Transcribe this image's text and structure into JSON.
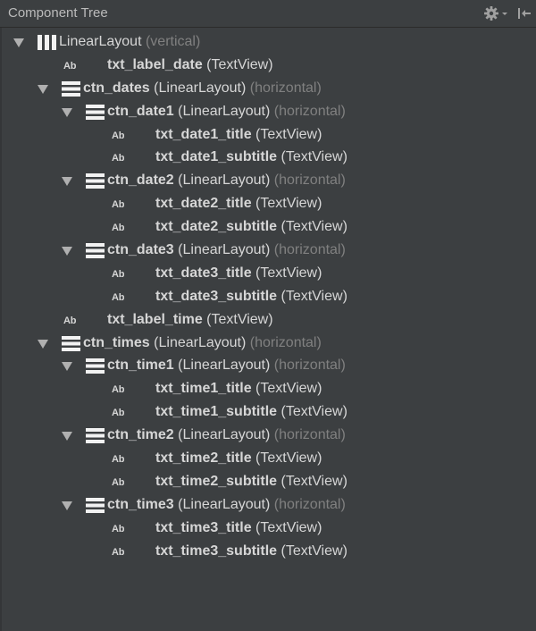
{
  "panel": {
    "title": "Component Tree",
    "settings_icon": "gear-dropdown-icon",
    "collapse_icon": "collapse-panel-icon"
  },
  "colors": {
    "background": "#3c3f41",
    "text": "#d6d6d6",
    "hint": "#808080"
  },
  "tree": [
    {
      "level": 0,
      "expanded": true,
      "icon": "vertical-layout-icon",
      "id": "",
      "type": "LinearLayout",
      "hint": "(vertical)"
    },
    {
      "level": 1,
      "expanded": null,
      "icon": "textview-icon",
      "id": "txt_label_date",
      "type": "(TextView)",
      "hint": ""
    },
    {
      "level": 1,
      "expanded": true,
      "icon": "horizontal-layout-icon",
      "id": "ctn_dates",
      "type": "(LinearLayout)",
      "hint": "(horizontal)"
    },
    {
      "level": 2,
      "expanded": true,
      "icon": "horizontal-layout-icon",
      "id": "ctn_date1",
      "type": "(LinearLayout)",
      "hint": "(horizontal)"
    },
    {
      "level": 3,
      "expanded": null,
      "icon": "textview-icon",
      "id": "txt_date1_title",
      "type": "(TextView)",
      "hint": ""
    },
    {
      "level": 3,
      "expanded": null,
      "icon": "textview-icon",
      "id": "txt_date1_subtitle",
      "type": "(TextView)",
      "hint": ""
    },
    {
      "level": 2,
      "expanded": true,
      "icon": "horizontal-layout-icon",
      "id": "ctn_date2",
      "type": "(LinearLayout)",
      "hint": "(horizontal)"
    },
    {
      "level": 3,
      "expanded": null,
      "icon": "textview-icon",
      "id": "txt_date2_title",
      "type": "(TextView)",
      "hint": ""
    },
    {
      "level": 3,
      "expanded": null,
      "icon": "textview-icon",
      "id": "txt_date2_subtitle",
      "type": "(TextView)",
      "hint": ""
    },
    {
      "level": 2,
      "expanded": true,
      "icon": "horizontal-layout-icon",
      "id": "ctn_date3",
      "type": "(LinearLayout)",
      "hint": "(horizontal)"
    },
    {
      "level": 3,
      "expanded": null,
      "icon": "textview-icon",
      "id": "txt_date3_title",
      "type": "(TextView)",
      "hint": ""
    },
    {
      "level": 3,
      "expanded": null,
      "icon": "textview-icon",
      "id": "txt_date3_subtitle",
      "type": "(TextView)",
      "hint": ""
    },
    {
      "level": 1,
      "expanded": null,
      "icon": "textview-icon",
      "id": "txt_label_time",
      "type": "(TextView)",
      "hint": ""
    },
    {
      "level": 1,
      "expanded": true,
      "icon": "horizontal-layout-icon",
      "id": "ctn_times",
      "type": "(LinearLayout)",
      "hint": "(horizontal)"
    },
    {
      "level": 2,
      "expanded": true,
      "icon": "horizontal-layout-icon",
      "id": "ctn_time1",
      "type": "(LinearLayout)",
      "hint": "(horizontal)"
    },
    {
      "level": 3,
      "expanded": null,
      "icon": "textview-icon",
      "id": "txt_time1_title",
      "type": "(TextView)",
      "hint": ""
    },
    {
      "level": 3,
      "expanded": null,
      "icon": "textview-icon",
      "id": "txt_time1_subtitle",
      "type": "(TextView)",
      "hint": ""
    },
    {
      "level": 2,
      "expanded": true,
      "icon": "horizontal-layout-icon",
      "id": "ctn_time2",
      "type": "(LinearLayout)",
      "hint": "(horizontal)"
    },
    {
      "level": 3,
      "expanded": null,
      "icon": "textview-icon",
      "id": "txt_time2_title",
      "type": "(TextView)",
      "hint": ""
    },
    {
      "level": 3,
      "expanded": null,
      "icon": "textview-icon",
      "id": "txt_time2_subtitle",
      "type": "(TextView)",
      "hint": ""
    },
    {
      "level": 2,
      "expanded": true,
      "icon": "horizontal-layout-icon",
      "id": "ctn_time3",
      "type": "(LinearLayout)",
      "hint": "(horizontal)"
    },
    {
      "level": 3,
      "expanded": null,
      "icon": "textview-icon",
      "id": "txt_time3_title",
      "type": "(TextView)",
      "hint": ""
    },
    {
      "level": 3,
      "expanded": null,
      "icon": "textview-icon",
      "id": "txt_time3_subtitle",
      "type": "(TextView)",
      "hint": ""
    }
  ],
  "textview_glyph": "Ab"
}
